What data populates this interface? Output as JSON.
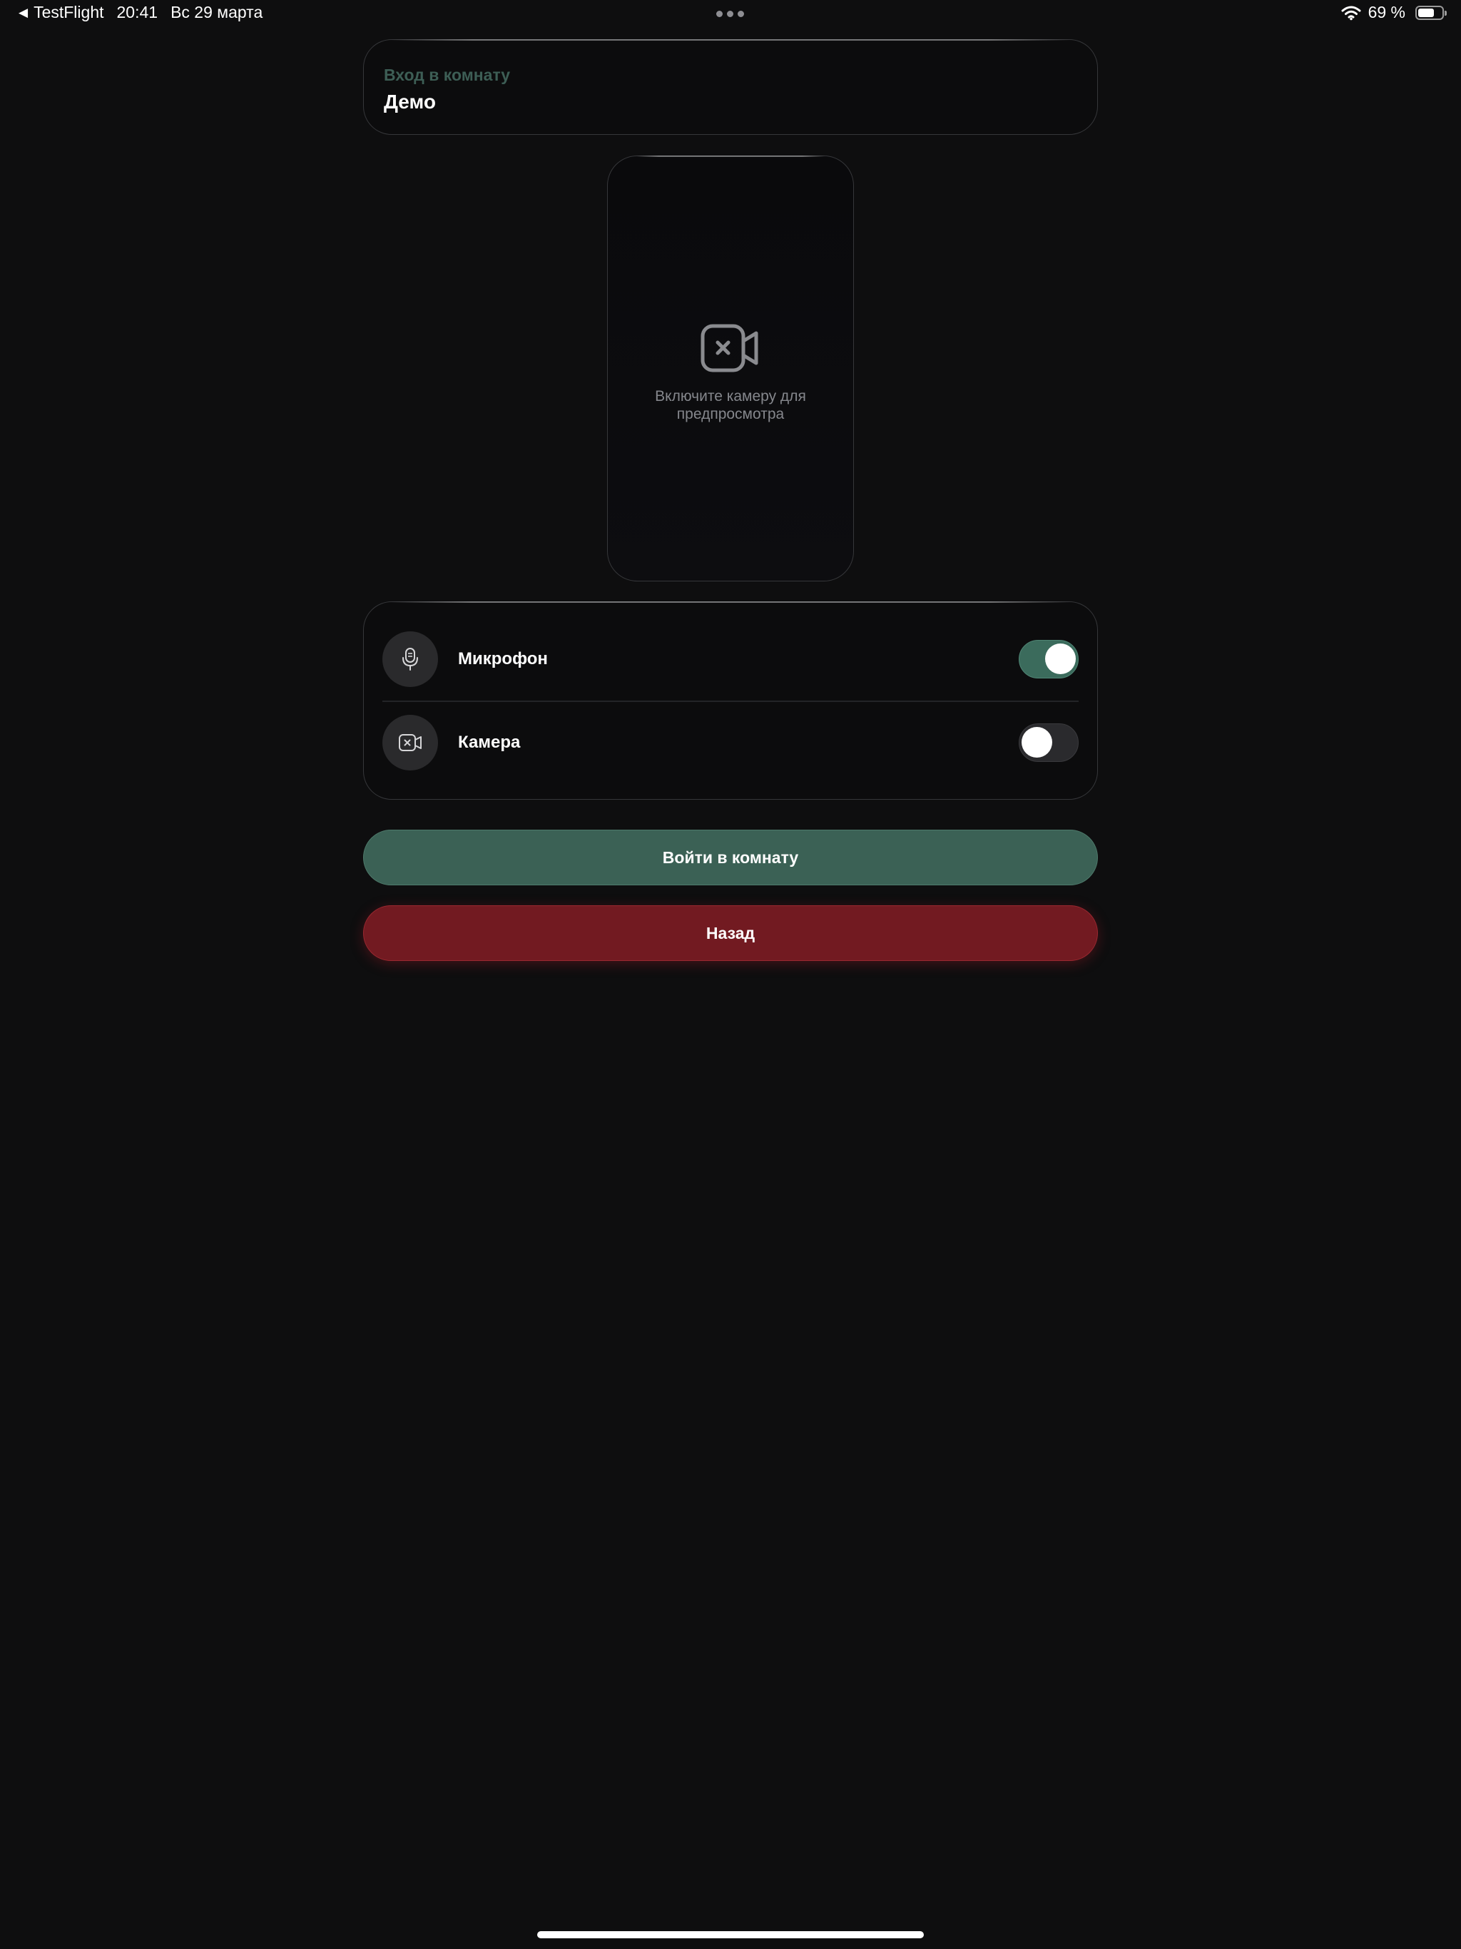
{
  "status_bar": {
    "back_app": "TestFlight",
    "time": "20:41",
    "date": "Вс 29 марта",
    "battery_percent": "69 %",
    "battery_level": 0.69,
    "icons": [
      "back-triangle-icon",
      "multitasking-dots-icon",
      "wifi-icon",
      "battery-icon"
    ]
  },
  "room": {
    "subtitle": "Вход в комнату",
    "name": "Демо"
  },
  "preview": {
    "icon": "camera-off-icon",
    "text": "Включите камеру для предпросмотра"
  },
  "controls": {
    "microphone": {
      "label": "Микрофон",
      "enabled": true,
      "icon": "microphone-icon"
    },
    "camera": {
      "label": "Камера",
      "enabled": false,
      "icon": "camera-off-icon"
    }
  },
  "actions": {
    "join_label": "Войти в комнату",
    "back_label": "Назад"
  },
  "colors": {
    "background": "#0e0e0f",
    "accent_green": "#3b6155",
    "toggle_on": "#3b6b5c",
    "danger_red": "#721a21",
    "subtitle_green": "#3d5e55"
  }
}
